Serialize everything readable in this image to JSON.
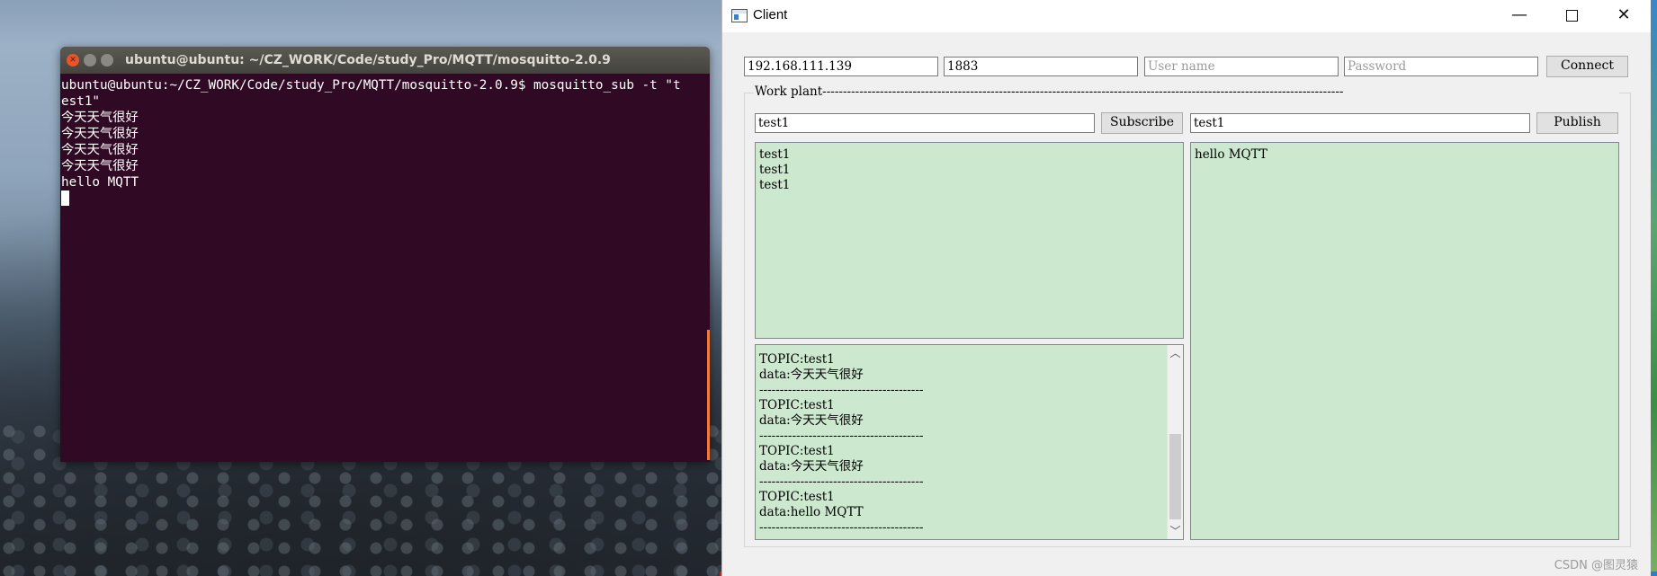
{
  "terminal": {
    "title": "ubuntu@ubuntu: ~/CZ_WORK/Code/study_Pro/MQTT/mosquitto-2.0.9",
    "lines": [
      "ubuntu@ubuntu:~/CZ_WORK/Code/study_Pro/MQTT/mosquitto-2.0.9$ mosquitto_sub -t \"t",
      "est1\"",
      "今天天气很好",
      "今天天气很好",
      "今天天气很好",
      "今天天气很好",
      "hello MQTT"
    ]
  },
  "client": {
    "title": "Client",
    "controls": {
      "minimize": "—",
      "close": "✕"
    },
    "host": "192.168.111.139",
    "port": "1883",
    "username_placeholder": "User name",
    "password_placeholder": "Password",
    "connect_label": "Connect",
    "group_title": "Work plant-------------------------------------------------------------------------------------------------------------------------------",
    "subscribe_topic": "test1",
    "subscribe_label": "Subscribe",
    "publish_topic": "test1",
    "publish_label": "Publish",
    "subscribed_list": [
      "test1",
      "test1",
      "test1"
    ],
    "messages": [
      "TOPIC:test1",
      "data:今天天气很好",
      "----------------------------------------",
      "TOPIC:test1",
      "data:今天天气很好",
      "----------------------------------------",
      "TOPIC:test1",
      "data:今天天气很好",
      "----------------------------------------",
      "TOPIC:test1",
      "data:hello MQTT",
      "----------------------------------------"
    ],
    "publish_text": "hello MQTT",
    "scroll_position": 0.95
  },
  "watermark": "CSDN @图灵猿"
}
